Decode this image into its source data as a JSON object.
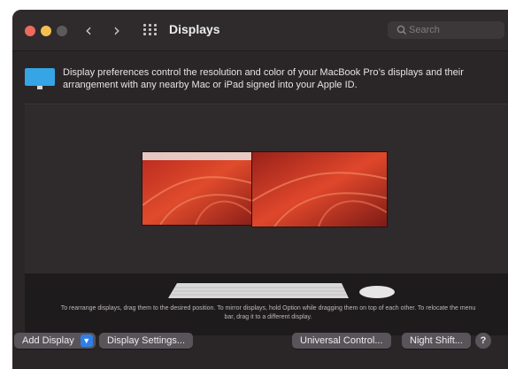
{
  "window": {
    "title": "Displays",
    "search_placeholder": "Search"
  },
  "toolbar": {
    "back_glyph": "‹",
    "forward_glyph": "›"
  },
  "info": {
    "text": "Display preferences control the resolution and color of your MacBook Pro’s displays and their arrangement with any nearby Mac or iPad signed into your Apple ID."
  },
  "arrangement": {
    "hint": "To rearrange displays, drag them to the desired position. To mirror displays, hold Option while dragging them on top of each other. To relocate the menu bar, drag it to a different display."
  },
  "buttons": {
    "add_display": "Add Display",
    "display_settings": "Display Settings...",
    "universal_control": "Universal Control...",
    "night_shift": "Night Shift...",
    "help": "?"
  },
  "colors": {
    "traffic_red": "#ed6a5e",
    "traffic_yellow": "#f4bf4f",
    "accent_blue": "#2f7ee8",
    "wallpaper_orange": "#d9422a"
  },
  "icons": [
    "back-icon",
    "forward-icon",
    "grid-icon",
    "search-icon",
    "display-icon",
    "chevron-down-icon",
    "keyboard-icon",
    "mouse-icon"
  ]
}
